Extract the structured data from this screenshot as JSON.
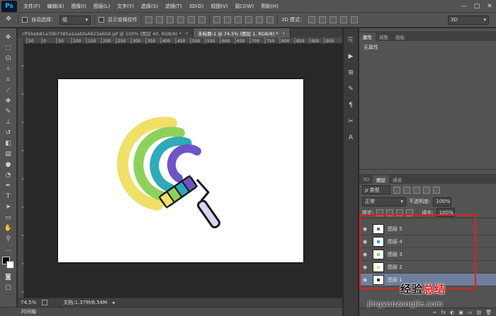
{
  "app": {
    "logo_text": "Ps"
  },
  "menu": [
    "文件(F)",
    "编辑(E)",
    "图像(I)",
    "图层(L)",
    "文字(Y)",
    "选择(S)",
    "滤镜(T)",
    "3D(D)",
    "视图(V)",
    "窗口(W)",
    "帮助(H)"
  ],
  "window_controls": [
    "—",
    "▢",
    "✕"
  ],
  "options_bar": {
    "auto_select_label": "自动选择：",
    "auto_select_value": "组",
    "show_transform_label": "显示变换控件",
    "mode_3d_label": "3D 模式：",
    "workspace_value": "3D"
  },
  "doc_tabs": [
    {
      "title": "cff4beb81a39b7385e2aabfa4823a60d.gif @ 100% (图层 40, RGB/8) *",
      "active": false
    },
    {
      "title": "未标题-1 @ 74.5% (图层 1, RGB/8) *",
      "active": true
    }
  ],
  "ruler_labels": [
    "50",
    "0",
    "50",
    "100",
    "150",
    "200",
    "250",
    "300",
    "350",
    "400",
    "450",
    "500",
    "550",
    "600",
    "650",
    "700",
    "750",
    "800",
    "850",
    "900",
    "950"
  ],
  "status": {
    "zoom": "74.5%",
    "doc_info": "文档:1.37M/6.54M"
  },
  "timeline_label": "时间轴",
  "properties_panel": {
    "tabs": [
      "属性",
      "调整",
      "画板"
    ],
    "no_properties_text": "无属性"
  },
  "layers_panel": {
    "tabs": [
      "3D",
      "图层",
      "通道"
    ],
    "filter_kind": "ρ 类型",
    "blend_mode": "正常",
    "opacity_label": "不透明度:",
    "opacity_value": "100%",
    "lock_label": "锁定:",
    "fill_label": "填充:",
    "fill_value": "100%",
    "layers": [
      {
        "name": "图层 5",
        "selected": false
      },
      {
        "name": "图层 4",
        "selected": false
      },
      {
        "name": "图层 3",
        "selected": false
      },
      {
        "name": "图层 2",
        "selected": false
      },
      {
        "name": "图层 1",
        "selected": true
      }
    ],
    "footer_icons": [
      "fx",
      "◐",
      "▣",
      "▭",
      "▤",
      "🗑"
    ]
  },
  "watermark": {
    "line1_prefix": "经验",
    "line1_suffix": "总结",
    "line2": "jingyanzongjie.com"
  },
  "colors": {
    "arc_yellow": "#f1e068",
    "arc_green": "#8ed15a",
    "arc_teal": "#2eaab8",
    "arc_purple": "#6d55c6",
    "highlight_red": "#e02020",
    "selected_layer": "#6f7f9b"
  }
}
